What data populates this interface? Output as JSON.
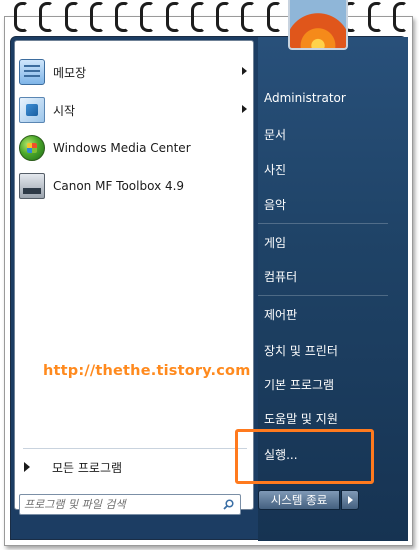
{
  "programs": [
    {
      "label": "메모장",
      "icon": "notepad-icon",
      "has_submenu": true
    },
    {
      "label": "시작",
      "icon": "getting-started-icon",
      "has_submenu": true
    },
    {
      "label": "Windows Media Center",
      "icon": "windows-media-center-icon",
      "has_submenu": false
    },
    {
      "label": "Canon MF Toolbox 4.9",
      "icon": "canon-toolbox-icon",
      "has_submenu": false
    }
  ],
  "watermark": "http://thethe.tistory.com",
  "all_programs_label": "모든 프로그램",
  "search": {
    "placeholder": "프로그램 및 파일 검색",
    "value": ""
  },
  "right_menu": {
    "user": "Administrator",
    "items": [
      "문서",
      "사진",
      "음악",
      "게임",
      "컴퓨터",
      "제어판",
      "장치 및 프린터",
      "기본 프로그램",
      "도움말 및 지원",
      "실행..."
    ]
  },
  "shutdown_label": "시스템 종료",
  "colors": {
    "highlight": "#ff7a1e",
    "watermark": "#ff8a1e",
    "menu_dark": "#1c3d63"
  }
}
